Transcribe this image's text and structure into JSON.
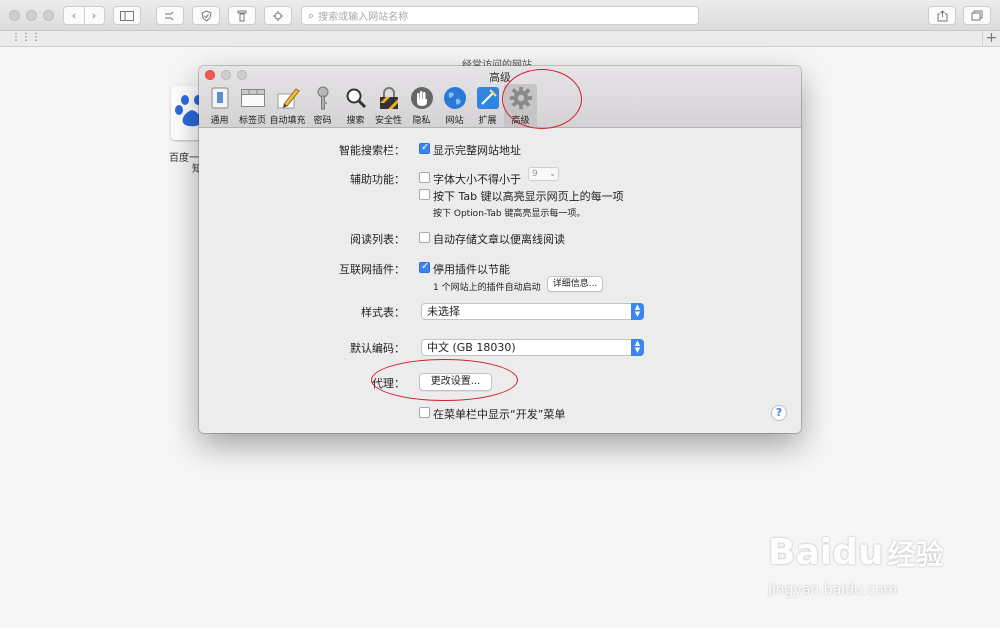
{
  "browser": {
    "address_placeholder": "搜索或输入网站名称",
    "background_heading": "经常访问的网站",
    "tile_label_line1": "百度一",
    "tile_label_line2": "知"
  },
  "prefs": {
    "window_title": "高级",
    "tabs": [
      {
        "label": "通用",
        "icon": "general-icon"
      },
      {
        "label": "标签页",
        "icon": "tabs-icon"
      },
      {
        "label": "自动填充",
        "icon": "autofill-pencil-icon"
      },
      {
        "label": "密码",
        "icon": "key-icon"
      },
      {
        "label": "搜索",
        "icon": "magnifier-icon"
      },
      {
        "label": "安全性",
        "icon": "lock-icon"
      },
      {
        "label": "隐私",
        "icon": "hand-icon"
      },
      {
        "label": "网站",
        "icon": "globe-icon"
      },
      {
        "label": "扩展",
        "icon": "puzzle-icon"
      },
      {
        "label": "高级",
        "icon": "gear-icon",
        "active": true
      }
    ],
    "smart_search": {
      "label": "智能搜索栏：",
      "option": "显示完整网站地址",
      "checked": true
    },
    "accessibility": {
      "label": "辅助功能：",
      "min_font_option": "字体大小不得小于",
      "min_font_checked": false,
      "min_font_value": "9",
      "tab_option": "按下 Tab 键以高亮显示网页上的每一项",
      "tab_checked": false,
      "tab_hint": "按下 Option-Tab 键高亮显示每一项。"
    },
    "reading_list": {
      "label": "阅读列表：",
      "option": "自动存储文章以便离线阅读",
      "checked": false
    },
    "internet_plugins": {
      "label": "互联网插件：",
      "option": "停用插件以节能",
      "checked": true,
      "hint": "1 个网站上的插件自动启动",
      "details_button": "详细信息..."
    },
    "stylesheet": {
      "label": "样式表：",
      "value": "未选择"
    },
    "default_encoding": {
      "label": "默认编码：",
      "value": "中文 (GB 18030)"
    },
    "proxies": {
      "label": "代理：",
      "button": "更改设置..."
    },
    "develop_menu": {
      "option": "在菜单栏中显示“开发”菜单",
      "checked": false
    },
    "help_label": "?"
  },
  "watermark": {
    "brand": "Bai",
    "brand2": "du",
    "brand_cn": "经验",
    "url": "jingyan.baidu.com"
  },
  "colors": {
    "accent": "#3b84f2",
    "annotation": "#d21f2a",
    "close_button": "#f25a53"
  }
}
